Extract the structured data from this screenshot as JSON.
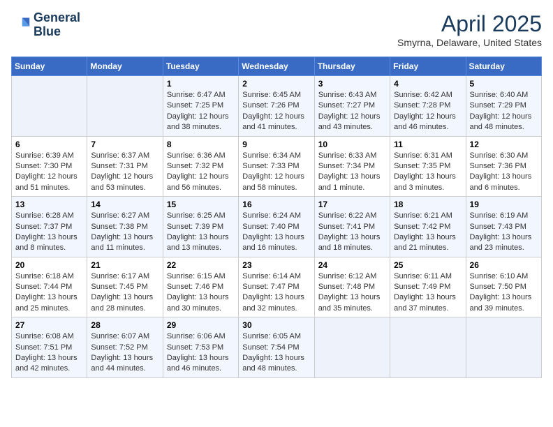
{
  "header": {
    "logo_line1": "General",
    "logo_line2": "Blue",
    "month": "April 2025",
    "location": "Smyrna, Delaware, United States"
  },
  "days_of_week": [
    "Sunday",
    "Monday",
    "Tuesday",
    "Wednesday",
    "Thursday",
    "Friday",
    "Saturday"
  ],
  "weeks": [
    [
      {
        "num": "",
        "sunrise": "",
        "sunset": "",
        "daylight": ""
      },
      {
        "num": "",
        "sunrise": "",
        "sunset": "",
        "daylight": ""
      },
      {
        "num": "1",
        "sunrise": "Sunrise: 6:47 AM",
        "sunset": "Sunset: 7:25 PM",
        "daylight": "Daylight: 12 hours and 38 minutes."
      },
      {
        "num": "2",
        "sunrise": "Sunrise: 6:45 AM",
        "sunset": "Sunset: 7:26 PM",
        "daylight": "Daylight: 12 hours and 41 minutes."
      },
      {
        "num": "3",
        "sunrise": "Sunrise: 6:43 AM",
        "sunset": "Sunset: 7:27 PM",
        "daylight": "Daylight: 12 hours and 43 minutes."
      },
      {
        "num": "4",
        "sunrise": "Sunrise: 6:42 AM",
        "sunset": "Sunset: 7:28 PM",
        "daylight": "Daylight: 12 hours and 46 minutes."
      },
      {
        "num": "5",
        "sunrise": "Sunrise: 6:40 AM",
        "sunset": "Sunset: 7:29 PM",
        "daylight": "Daylight: 12 hours and 48 minutes."
      }
    ],
    [
      {
        "num": "6",
        "sunrise": "Sunrise: 6:39 AM",
        "sunset": "Sunset: 7:30 PM",
        "daylight": "Daylight: 12 hours and 51 minutes."
      },
      {
        "num": "7",
        "sunrise": "Sunrise: 6:37 AM",
        "sunset": "Sunset: 7:31 PM",
        "daylight": "Daylight: 12 hours and 53 minutes."
      },
      {
        "num": "8",
        "sunrise": "Sunrise: 6:36 AM",
        "sunset": "Sunset: 7:32 PM",
        "daylight": "Daylight: 12 hours and 56 minutes."
      },
      {
        "num": "9",
        "sunrise": "Sunrise: 6:34 AM",
        "sunset": "Sunset: 7:33 PM",
        "daylight": "Daylight: 12 hours and 58 minutes."
      },
      {
        "num": "10",
        "sunrise": "Sunrise: 6:33 AM",
        "sunset": "Sunset: 7:34 PM",
        "daylight": "Daylight: 13 hours and 1 minute."
      },
      {
        "num": "11",
        "sunrise": "Sunrise: 6:31 AM",
        "sunset": "Sunset: 7:35 PM",
        "daylight": "Daylight: 13 hours and 3 minutes."
      },
      {
        "num": "12",
        "sunrise": "Sunrise: 6:30 AM",
        "sunset": "Sunset: 7:36 PM",
        "daylight": "Daylight: 13 hours and 6 minutes."
      }
    ],
    [
      {
        "num": "13",
        "sunrise": "Sunrise: 6:28 AM",
        "sunset": "Sunset: 7:37 PM",
        "daylight": "Daylight: 13 hours and 8 minutes."
      },
      {
        "num": "14",
        "sunrise": "Sunrise: 6:27 AM",
        "sunset": "Sunset: 7:38 PM",
        "daylight": "Daylight: 13 hours and 11 minutes."
      },
      {
        "num": "15",
        "sunrise": "Sunrise: 6:25 AM",
        "sunset": "Sunset: 7:39 PM",
        "daylight": "Daylight: 13 hours and 13 minutes."
      },
      {
        "num": "16",
        "sunrise": "Sunrise: 6:24 AM",
        "sunset": "Sunset: 7:40 PM",
        "daylight": "Daylight: 13 hours and 16 minutes."
      },
      {
        "num": "17",
        "sunrise": "Sunrise: 6:22 AM",
        "sunset": "Sunset: 7:41 PM",
        "daylight": "Daylight: 13 hours and 18 minutes."
      },
      {
        "num": "18",
        "sunrise": "Sunrise: 6:21 AM",
        "sunset": "Sunset: 7:42 PM",
        "daylight": "Daylight: 13 hours and 21 minutes."
      },
      {
        "num": "19",
        "sunrise": "Sunrise: 6:19 AM",
        "sunset": "Sunset: 7:43 PM",
        "daylight": "Daylight: 13 hours and 23 minutes."
      }
    ],
    [
      {
        "num": "20",
        "sunrise": "Sunrise: 6:18 AM",
        "sunset": "Sunset: 7:44 PM",
        "daylight": "Daylight: 13 hours and 25 minutes."
      },
      {
        "num": "21",
        "sunrise": "Sunrise: 6:17 AM",
        "sunset": "Sunset: 7:45 PM",
        "daylight": "Daylight: 13 hours and 28 minutes."
      },
      {
        "num": "22",
        "sunrise": "Sunrise: 6:15 AM",
        "sunset": "Sunset: 7:46 PM",
        "daylight": "Daylight: 13 hours and 30 minutes."
      },
      {
        "num": "23",
        "sunrise": "Sunrise: 6:14 AM",
        "sunset": "Sunset: 7:47 PM",
        "daylight": "Daylight: 13 hours and 32 minutes."
      },
      {
        "num": "24",
        "sunrise": "Sunrise: 6:12 AM",
        "sunset": "Sunset: 7:48 PM",
        "daylight": "Daylight: 13 hours and 35 minutes."
      },
      {
        "num": "25",
        "sunrise": "Sunrise: 6:11 AM",
        "sunset": "Sunset: 7:49 PM",
        "daylight": "Daylight: 13 hours and 37 minutes."
      },
      {
        "num": "26",
        "sunrise": "Sunrise: 6:10 AM",
        "sunset": "Sunset: 7:50 PM",
        "daylight": "Daylight: 13 hours and 39 minutes."
      }
    ],
    [
      {
        "num": "27",
        "sunrise": "Sunrise: 6:08 AM",
        "sunset": "Sunset: 7:51 PM",
        "daylight": "Daylight: 13 hours and 42 minutes."
      },
      {
        "num": "28",
        "sunrise": "Sunrise: 6:07 AM",
        "sunset": "Sunset: 7:52 PM",
        "daylight": "Daylight: 13 hours and 44 minutes."
      },
      {
        "num": "29",
        "sunrise": "Sunrise: 6:06 AM",
        "sunset": "Sunset: 7:53 PM",
        "daylight": "Daylight: 13 hours and 46 minutes."
      },
      {
        "num": "30",
        "sunrise": "Sunrise: 6:05 AM",
        "sunset": "Sunset: 7:54 PM",
        "daylight": "Daylight: 13 hours and 48 minutes."
      },
      {
        "num": "",
        "sunrise": "",
        "sunset": "",
        "daylight": ""
      },
      {
        "num": "",
        "sunrise": "",
        "sunset": "",
        "daylight": ""
      },
      {
        "num": "",
        "sunrise": "",
        "sunset": "",
        "daylight": ""
      }
    ]
  ]
}
